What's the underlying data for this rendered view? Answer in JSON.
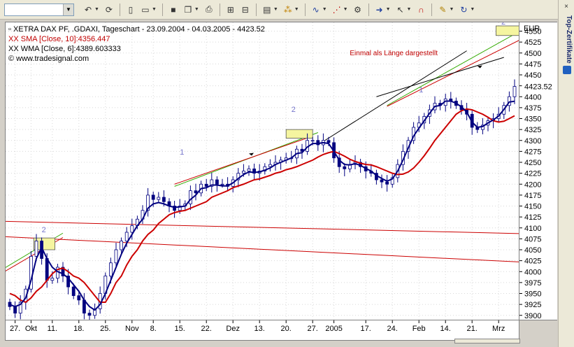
{
  "toolbar": {
    "combo_value": "",
    "icons": [
      "undo-icon",
      "refresh-icon",
      "new-doc-icon",
      "open-icon",
      "save-icon",
      "copy-icon",
      "print-icon",
      "bookmark-icon",
      "bookmark-next-icon",
      "window-icon",
      "indicator-icon",
      "drawing-icon",
      "trend-icon",
      "settings-icon",
      "arrow-right-icon",
      "cursor-icon",
      "magnet-icon",
      "note-icon",
      "rotate-icon"
    ]
  },
  "side_panel": {
    "title": "Top-Zertifikate"
  },
  "chart_data": {
    "type": "candlestick",
    "title": "XETRA DAX PF, .GDAXI, Tageschart - 23.09.2004 - 04.03.2005 - 4423.52",
    "legend": [
      {
        "text": "XETRA DAX PF, .GDAXI, Tageschart - 23.09.2004 - 04.03.2005 - 4423.52",
        "color": "#000000"
      },
      {
        "text": "XX SMA [Close, 10]:4356.447",
        "color": "#c00000"
      },
      {
        "text": "XX WMA [Close, 6]:4389.603333",
        "color": "#000000"
      },
      {
        "text": "www.tradesignal.com",
        "color": "#000000"
      }
    ],
    "currency": "EUR",
    "last_price": 4423.52,
    "ylim": [
      3890,
      4570
    ],
    "y_ticks": [
      3900,
      3925,
      3950,
      3975,
      4000,
      4025,
      4050,
      4075,
      4100,
      4125,
      4150,
      4175,
      4200,
      4225,
      4250,
      4275,
      4300,
      4325,
      4350,
      4375,
      4400,
      4425,
      4450,
      4475,
      4500,
      4525,
      4550
    ],
    "x_ticks": [
      {
        "i": 1,
        "label": "27."
      },
      {
        "i": 4,
        "label": "Okt"
      },
      {
        "i": 8,
        "label": "11."
      },
      {
        "i": 13,
        "label": "18."
      },
      {
        "i": 18,
        "label": "25."
      },
      {
        "i": 23,
        "label": "Nov"
      },
      {
        "i": 27,
        "label": "8."
      },
      {
        "i": 32,
        "label": "15."
      },
      {
        "i": 37,
        "label": "22."
      },
      {
        "i": 42,
        "label": "Dez"
      },
      {
        "i": 47,
        "label": "13."
      },
      {
        "i": 52,
        "label": "20."
      },
      {
        "i": 57,
        "label": "27."
      },
      {
        "i": 61,
        "label": "2005"
      },
      {
        "i": 67,
        "label": "17."
      },
      {
        "i": 72,
        "label": "24."
      },
      {
        "i": 77,
        "label": "Feb"
      },
      {
        "i": 82,
        "label": "14."
      },
      {
        "i": 87,
        "label": "21."
      },
      {
        "i": 92,
        "label": "Mrz"
      }
    ],
    "close": [
      3920,
      3905,
      3930,
      3960,
      4035,
      4070,
      4030,
      3980,
      3985,
      4010,
      3990,
      3965,
      3945,
      3935,
      3905,
      3900,
      3915,
      3950,
      3990,
      4020,
      4050,
      4070,
      4090,
      4105,
      4120,
      4140,
      4175,
      4165,
      4170,
      4160,
      4150,
      4140,
      4150,
      4155,
      4185,
      4180,
      4200,
      4195,
      4210,
      4200,
      4200,
      4195,
      4210,
      4225,
      4230,
      4235,
      4225,
      4230,
      4240,
      4245,
      4250,
      4255,
      4260,
      4260,
      4280,
      4275,
      4300,
      4300,
      4290,
      4300,
      4295,
      4260,
      4240,
      4235,
      4245,
      4250,
      4240,
      4230,
      4225,
      4210,
      4205,
      4200,
      4215,
      4245,
      4275,
      4300,
      4330,
      4340,
      4355,
      4370,
      4385,
      4380,
      4395,
      4390,
      4380,
      4370,
      4360,
      4330,
      4325,
      4335,
      4345,
      4350,
      4360,
      4380,
      4400,
      4423.52
    ],
    "sma": [
      3950,
      3945,
      3935,
      3930,
      3940,
      3955,
      3965,
      3980,
      3995,
      4005,
      4008,
      4000,
      3990,
      3985,
      3975,
      3960,
      3945,
      3930,
      3930,
      3950,
      3975,
      3990,
      4015,
      4035,
      4050,
      4070,
      4085,
      4095,
      4110,
      4120,
      4130,
      4135,
      4138,
      4140,
      4145,
      4150,
      4155,
      4160,
      4170,
      4175,
      4180,
      4185,
      4192,
      4196,
      4200,
      4205,
      4210,
      4212,
      4216,
      4220,
      4225,
      4228,
      4233,
      4236,
      4240,
      4245,
      4250,
      4255,
      4262,
      4268,
      4272,
      4275,
      4270,
      4264,
      4257,
      4252,
      4248,
      4245,
      4244,
      4240,
      4235,
      4230,
      4225,
      4222,
      4223,
      4228,
      4237,
      4250,
      4265,
      4282,
      4300,
      4315,
      4330,
      4345,
      4360,
      4368,
      4372,
      4370,
      4365,
      4360,
      4353,
      4345,
      4342,
      4344,
      4350,
      4356.447
    ],
    "wma": [
      3925,
      3920,
      3925,
      3940,
      3980,
      4030,
      4055,
      4030,
      4010,
      4000,
      3995,
      3985,
      3970,
      3955,
      3935,
      3920,
      3912,
      3925,
      3950,
      3980,
      4010,
      4040,
      4065,
      4085,
      4105,
      4120,
      4145,
      4155,
      4158,
      4155,
      4150,
      4147,
      4148,
      4150,
      4165,
      4175,
      4190,
      4192,
      4198,
      4198,
      4196,
      4196,
      4203,
      4213,
      4222,
      4228,
      4227,
      4228,
      4232,
      4237,
      4245,
      4250,
      4255,
      4260,
      4270,
      4272,
      4285,
      4293,
      4293,
      4295,
      4293,
      4275,
      4255,
      4245,
      4244,
      4247,
      4243,
      4236,
      4230,
      4220,
      4213,
      4207,
      4212,
      4230,
      4255,
      4283,
      4310,
      4328,
      4345,
      4362,
      4378,
      4380,
      4390,
      4390,
      4385,
      4377,
      4365,
      4342,
      4330,
      4332,
      4340,
      4347,
      4356,
      4371,
      4388,
      4389.603333
    ],
    "annotations": [
      {
        "text": "Einmal als Länge dargestellt",
        "color": "#c00000"
      },
      {
        "text": "1",
        "color": "#7777cc"
      },
      {
        "text": "2",
        "color": "#7777cc"
      },
      {
        "text": "1",
        "color": "#7777cc"
      },
      {
        "text": "2",
        "color": "#7777cc"
      },
      {
        "text": "2",
        "color": "#7777cc"
      }
    ],
    "colors": {
      "sma": "#cc0000",
      "wma": "#000080",
      "candle": "#000080",
      "channel": "#cc0000",
      "trend": "#33aa00",
      "box_fill": "#f5f5a0"
    }
  }
}
